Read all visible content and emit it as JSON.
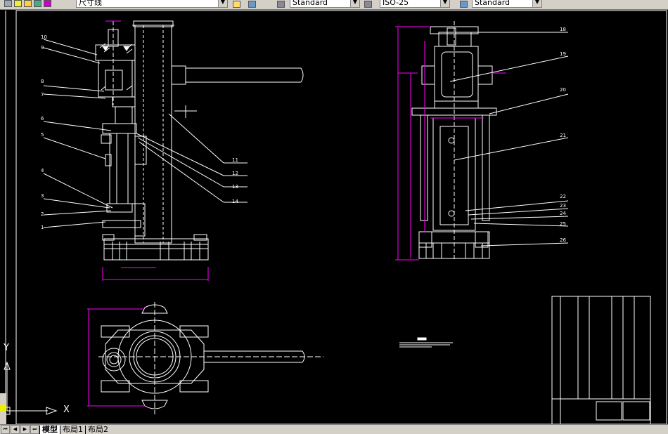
{
  "toolbar": {
    "layer_name": "尺寸线",
    "text_style": "Standard",
    "dim_style": "ISO-25",
    "table_style": "Standard"
  },
  "ucs": {
    "x_label": "X",
    "y_label": "Y"
  },
  "tabs": [
    {
      "label": "模型",
      "active": true
    },
    {
      "label": "布局1",
      "active": false
    },
    {
      "label": "布局2",
      "active": false
    }
  ],
  "balloons_left": [
    "10",
    "9",
    "8",
    "7",
    "6",
    "5",
    "4",
    "3",
    "2",
    "1"
  ],
  "balloons_mid": [
    "11",
    "12",
    "13",
    "14"
  ],
  "balloons_right": [
    "18",
    "19",
    "20",
    "21",
    "22",
    "23",
    "24",
    "25",
    "26"
  ],
  "colors": {
    "drawing": "#ffffff",
    "dimension": "#ff00ff",
    "background": "#000000",
    "toolbar": "#d4d0c8"
  }
}
